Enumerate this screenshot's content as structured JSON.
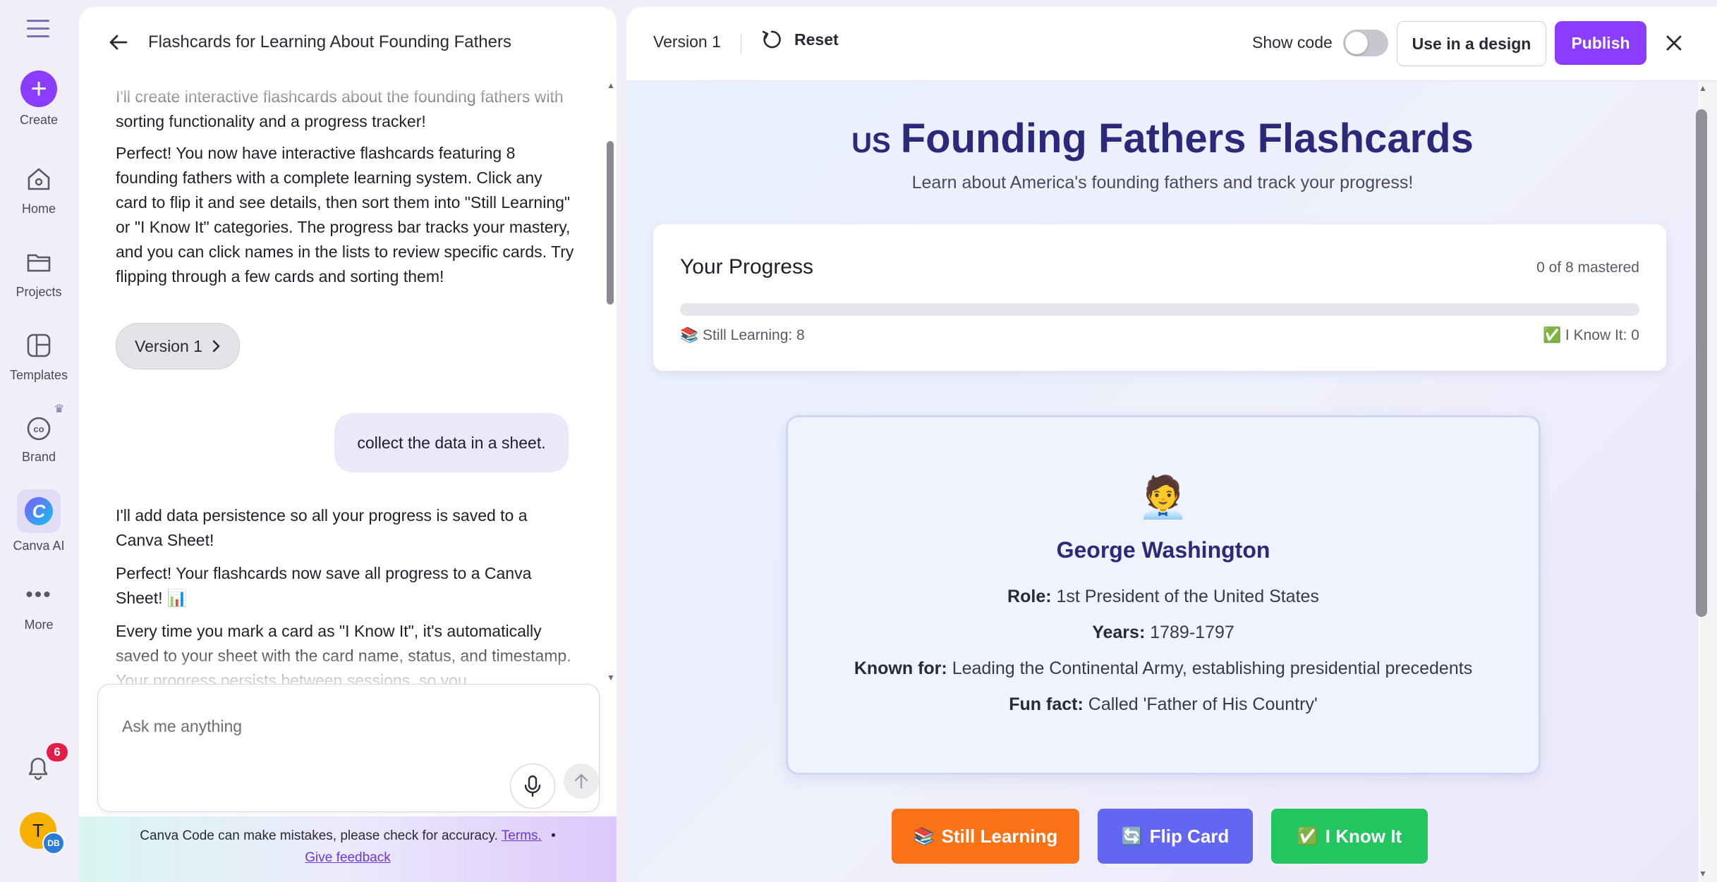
{
  "rail": {
    "create_label": "Create",
    "home_label": "Home",
    "projects_label": "Projects",
    "templates_label": "Templates",
    "brand_label": "Brand",
    "canva_ai_label": "Canva AI",
    "more_label": "More",
    "notification_count": "6",
    "avatar_initial": "T",
    "avatar_sub": "DB"
  },
  "chat": {
    "title": "Flashcards for Learning About Founding Fathers",
    "messages": {
      "ai_1": "I'll create interactive flashcards about the founding fathers with sorting functionality and a progress tracker!",
      "ai_2": "Perfect! You now have interactive flashcards featuring 8 founding fathers with a complete learning system. Click any card to flip it and see details, then sort them into \"Still Learning\" or \"I Know It\" categories. The progress bar tracks your mastery, and you can click names in the lists to review specific cards. Try flipping through a few cards and sorting them!",
      "version_chip": "Version 1",
      "user_1": "collect the data in a sheet.",
      "ai_3": "I'll add data persistence so all your progress is saved to a Canva Sheet!",
      "ai_4": "Perfect! Your flashcards now save all progress to a Canva Sheet! 📊",
      "ai_5": "Every time you mark a card as \"I Know It\", it's automatically saved to your sheet with the card name, status, and timestamp. Your progress persists between sessions, so you"
    },
    "input_placeholder": "Ask me anything",
    "disclaimer": "Canva Code can make mistakes, please check for accuracy.",
    "terms_link": "Terms.",
    "bullet": "•",
    "feedback_link": "Give feedback"
  },
  "preview": {
    "version": "Version 1",
    "reset_label": "Reset",
    "show_code_label": "Show code",
    "show_code_on": false,
    "use_in_design_label": "Use in a design",
    "publish_label": "Publish",
    "accent_color": "#8b3dff"
  },
  "app": {
    "flag": "US",
    "title": "Founding Fathers Flashcards",
    "subtitle": "Learn about America's founding fathers and track your progress!",
    "progress": {
      "title": "Your Progress",
      "count_text": "0 of 8 mastered",
      "fraction": 0,
      "still_learning_text": "📚 Still Learning: 8",
      "know_it_text": "✅ I Know It: 0"
    },
    "card": {
      "emoji": "🧑‍💼",
      "name": "George Washington",
      "role_label": "Role:",
      "role": "1st President of the United States",
      "years_label": "Years:",
      "years": "1789-1797",
      "known_label": "Known for:",
      "known": "Leading the Continental Army, establishing presidential precedents",
      "fun_label": "Fun fact:",
      "fun": "Called 'Father of His Country'"
    },
    "buttons": {
      "still_emoji": "📚",
      "still_label": "Still Learning",
      "still_color": "#f97316",
      "flip_emoji": "🔄",
      "flip_label": "Flip Card",
      "flip_color": "#6366f1",
      "know_emoji": "✅",
      "know_label": "I Know It",
      "know_color": "#22c55e"
    }
  }
}
